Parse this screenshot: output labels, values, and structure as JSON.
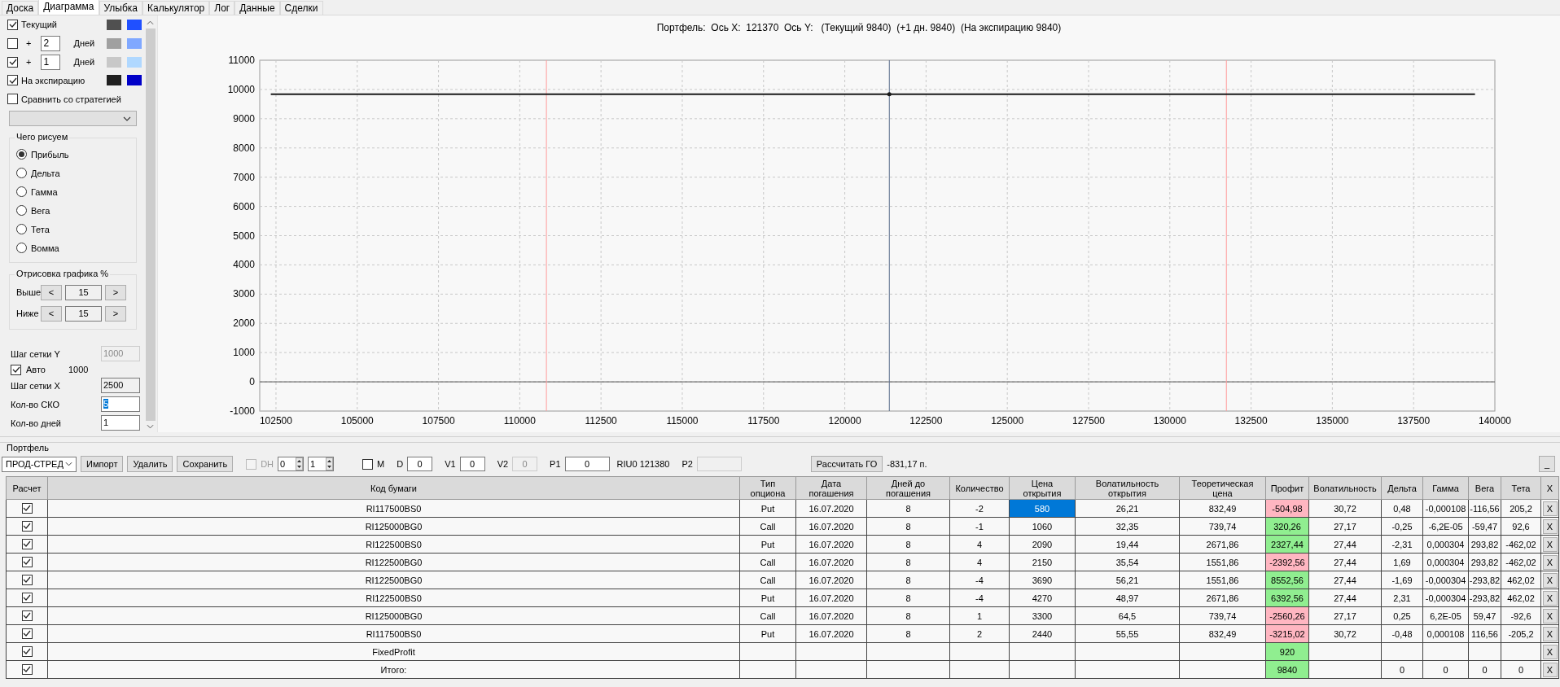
{
  "tabs": [
    {
      "label": "Доска",
      "selected": false
    },
    {
      "label": "Диаграмма",
      "selected": true
    },
    {
      "label": "Улыбка",
      "selected": false
    },
    {
      "label": "Калькулятор",
      "selected": false
    },
    {
      "label": "Лог",
      "selected": false
    },
    {
      "label": "Данные",
      "selected": false
    },
    {
      "label": "Сделки",
      "selected": false
    }
  ],
  "display": {
    "lines": [
      {
        "kind": "label",
        "label": "Текущий",
        "checked": true,
        "swatches": [
          {
            "color": "#505050"
          },
          {
            "color": "#2050ff"
          }
        ]
      },
      {
        "kind": "offset",
        "plus": "+",
        "days": "2",
        "unit": "Дней",
        "checked": false,
        "swatches": [
          {
            "color": "#a0a0a0"
          },
          {
            "color": "#80a8ff"
          }
        ]
      },
      {
        "kind": "offset",
        "plus": "+",
        "days": "1",
        "unit": "Дней",
        "checked": true,
        "swatches": [
          {
            "color": "#c8c8c8"
          },
          {
            "color": "#b0d8ff"
          }
        ]
      },
      {
        "kind": "label",
        "label": "На экспирацию",
        "checked": true,
        "swatches": [
          {
            "color": "#202020"
          },
          {
            "color": "#0000c8"
          }
        ]
      }
    ],
    "compare": {
      "label": "Сравнить со стратегией",
      "checked": false
    },
    "draw_what": {
      "title": "Чего рисуем",
      "options": [
        {
          "label": "Прибыль",
          "selected": true
        },
        {
          "label": "Дельта",
          "selected": false
        },
        {
          "label": "Гамма",
          "selected": false
        },
        {
          "label": "Вега",
          "selected": false
        },
        {
          "label": "Тета",
          "selected": false
        },
        {
          "label": "Вомма",
          "selected": false
        }
      ]
    },
    "range": {
      "title": "Отрисовка графика %",
      "rows": [
        {
          "label": "Выше",
          "dec": "<",
          "value": "15",
          "inc": ">"
        },
        {
          "label": "Ниже",
          "dec": "<",
          "value": "15",
          "inc": ">"
        }
      ]
    },
    "grid": {
      "y_label": "Шаг сетки Y",
      "y_value": "1000",
      "auto_label": "Авто",
      "auto_checked": true,
      "auto_value": "1000",
      "x_label": "Шаг сетки X",
      "x_value": "2500",
      "sko_label": "Кол-во СКО",
      "sko_value": "5",
      "days_label": "Кол-во дней",
      "days_value": "1"
    }
  },
  "chart": {
    "title": "Портфель:  Ось X:  121370  Ось Y:   (Текущий 9840)  (+1 дн. 9840)  (На экспирацию 9840)",
    "chart_data": {
      "type": "line",
      "x": [
        102340,
        121370,
        139390
      ],
      "series": [
        {
          "color": "#1a1a1a",
          "values": [
            9840,
            9840,
            9840
          ]
        }
      ],
      "xlim": [
        102000,
        140000
      ],
      "ylim": [
        -1000,
        11000
      ],
      "grid": true,
      "xticks": [
        102500,
        105000,
        107500,
        110000,
        112500,
        115000,
        117500,
        120000,
        122500,
        125000,
        127500,
        130000,
        132500,
        135000,
        137500,
        140000
      ],
      "yticks": [
        -1000,
        0,
        1000,
        2000,
        3000,
        4000,
        5000,
        6000,
        7000,
        8000,
        9000,
        10000,
        11000
      ],
      "ref_lines": [
        {
          "axis": "x",
          "value": 110820,
          "color": "#ff9a9a"
        },
        {
          "axis": "x",
          "value": 131740,
          "color": "#ff9a9a"
        },
        {
          "axis": "x",
          "value": 121370,
          "color": "#5a6e8c"
        }
      ]
    }
  },
  "portfolio": {
    "title": "Портфель",
    "strategy": "ПРОД-СТРЕД",
    "buttons": [
      "Импорт",
      "Удалить",
      "Сохранить"
    ],
    "dh": {
      "label": "DH",
      "checked": false,
      "disabled": true
    },
    "spinners": [
      "0",
      "1"
    ],
    "m": {
      "label": "M",
      "checked": false
    },
    "fields": [
      {
        "kind": "field",
        "label": "D",
        "value": "0",
        "disabled": false
      },
      {
        "kind": "field",
        "label": "V1",
        "value": "0",
        "disabled": false
      },
      {
        "kind": "field",
        "label": "V2",
        "value": "0",
        "disabled": true
      },
      {
        "kind": "long_field",
        "label": "P1",
        "value": "0",
        "disabled": false
      },
      {
        "kind": "text",
        "label": "RIU0 121380"
      },
      {
        "kind": "long_field",
        "label": "P2",
        "disabled": true
      }
    ],
    "calc_button": "Рассчитать ГО",
    "go_value": "-831,17 п.",
    "minimize": "_"
  },
  "table": {
    "columns": [
      "Расчет",
      "Код бумаги",
      "Тип\nопциона",
      "Дата\nпогашения",
      "Дней до\nпогашения",
      "Количество",
      "Цена\nоткрытия",
      "Волатильность\nоткрытия",
      "Теоретическая\nцена",
      "Профит",
      "Волатильность",
      "Дельта",
      "Гамма",
      "Вега",
      "Тета",
      "X"
    ],
    "rows": [
      {
        "checked": true,
        "code": "RI117500BS0",
        "type": "Put",
        "expiry": "16.07.2020",
        "days": "8",
        "qty": "-2",
        "open_price": "580",
        "open_vol": "26,21",
        "theor": "832,49",
        "profit": "-504,98",
        "color": "#ffb6c1",
        "vol": "30,72",
        "delta": "0,48",
        "gamma": "-0,000108",
        "vega": "-116,56",
        "theta": "205,2",
        "remove": "X",
        "selected": true
      },
      {
        "checked": true,
        "code": "RI125000BG0",
        "type": "Call",
        "expiry": "16.07.2020",
        "days": "8",
        "qty": "-1",
        "open_price": "1060",
        "open_vol": "32,35",
        "theor": "739,74",
        "profit": "320,26",
        "color": "#90ee90",
        "vol": "27,17",
        "delta": "-0,25",
        "gamma": "-6,2E-05",
        "vega": "-59,47",
        "theta": "92,6",
        "remove": "X",
        "selected": false
      },
      {
        "checked": true,
        "code": "RI122500BS0",
        "type": "Put",
        "expiry": "16.07.2020",
        "days": "8",
        "qty": "4",
        "open_price": "2090",
        "open_vol": "19,44",
        "theor": "2671,86",
        "profit": "2327,44",
        "color": "#90ee90",
        "vol": "27,44",
        "delta": "-2,31",
        "gamma": "0,000304",
        "vega": "293,82",
        "theta": "-462,02",
        "remove": "X",
        "selected": false
      },
      {
        "checked": true,
        "code": "RI122500BG0",
        "type": "Call",
        "expiry": "16.07.2020",
        "days": "8",
        "qty": "4",
        "open_price": "2150",
        "open_vol": "35,54",
        "theor": "1551,86",
        "profit": "-2392,56",
        "color": "#ffb6c1",
        "vol": "27,44",
        "delta": "1,69",
        "gamma": "0,000304",
        "vega": "293,82",
        "theta": "-462,02",
        "remove": "X",
        "selected": false
      },
      {
        "checked": true,
        "code": "RI122500BG0",
        "type": "Call",
        "expiry": "16.07.2020",
        "days": "8",
        "qty": "-4",
        "open_price": "3690",
        "open_vol": "56,21",
        "theor": "1551,86",
        "profit": "8552,56",
        "color": "#90ee90",
        "vol": "27,44",
        "delta": "-1,69",
        "gamma": "-0,000304",
        "vega": "-293,82",
        "theta": "462,02",
        "remove": "X",
        "selected": false
      },
      {
        "checked": true,
        "code": "RI122500BS0",
        "type": "Put",
        "expiry": "16.07.2020",
        "days": "8",
        "qty": "-4",
        "open_price": "4270",
        "open_vol": "48,97",
        "theor": "2671,86",
        "profit": "6392,56",
        "color": "#90ee90",
        "vol": "27,44",
        "delta": "2,31",
        "gamma": "-0,000304",
        "vega": "-293,82",
        "theta": "462,02",
        "remove": "X",
        "selected": false
      },
      {
        "checked": true,
        "code": "RI125000BG0",
        "type": "Call",
        "expiry": "16.07.2020",
        "days": "8",
        "qty": "1",
        "open_price": "3300",
        "open_vol": "64,5",
        "theor": "739,74",
        "profit": "-2560,26",
        "color": "#ffb6c1",
        "vol": "27,17",
        "delta": "0,25",
        "gamma": "6,2E-05",
        "vega": "59,47",
        "theta": "-92,6",
        "remove": "X",
        "selected": false
      },
      {
        "checked": true,
        "code": "RI117500BS0",
        "type": "Put",
        "expiry": "16.07.2020",
        "days": "8",
        "qty": "2",
        "open_price": "2440",
        "open_vol": "55,55",
        "theor": "832,49",
        "profit": "-3215,02",
        "color": "#ffb6c1",
        "vol": "30,72",
        "delta": "-0,48",
        "gamma": "0,000108",
        "vega": "116,56",
        "theta": "-205,2",
        "remove": "X",
        "selected": false
      },
      {
        "checked": true,
        "code": "FixedProfit",
        "profit": "920",
        "color": "#90ee90",
        "remove": "X",
        "selected": false
      },
      {
        "checked": true,
        "code": "Итого:",
        "profit": "9840",
        "color": "#90ee90",
        "delta": "0",
        "gamma": "0",
        "vega": "0",
        "theta": "0",
        "remove": "X",
        "selected": false
      }
    ]
  }
}
